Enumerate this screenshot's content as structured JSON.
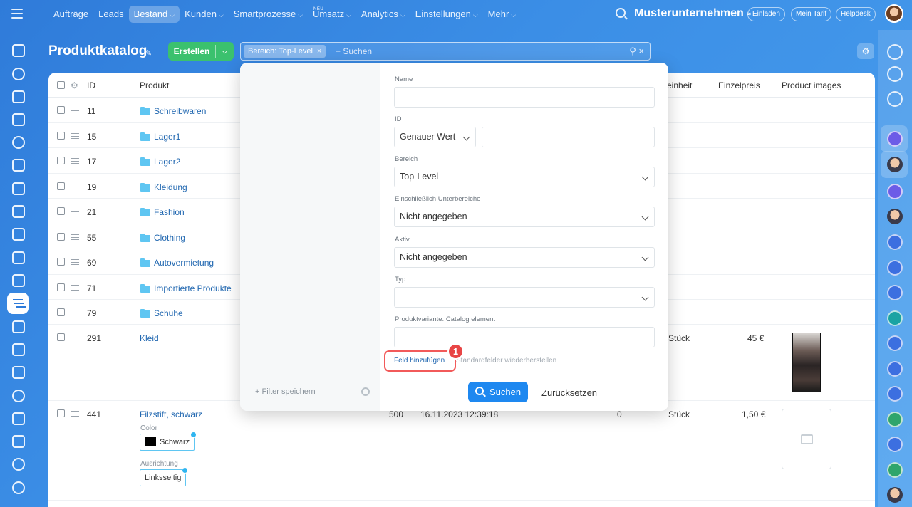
{
  "topnav": {
    "items": [
      {
        "label": "Aufträge",
        "chev": ""
      },
      {
        "label": "Leads",
        "chev": ""
      },
      {
        "label": "Bestand",
        "chev": "⌵"
      },
      {
        "label": "Kunden",
        "chev": "⌵"
      },
      {
        "label": "Smartprozesse",
        "chev": "⌵"
      },
      {
        "label": "Umsatz",
        "chev": "⌵",
        "badge": "NEU"
      },
      {
        "label": "Analytics",
        "chev": "⌵"
      },
      {
        "label": "Einstellungen",
        "chev": "⌵"
      },
      {
        "label": "Mehr",
        "chev": "⌵"
      }
    ],
    "company": "Musterunternehmen",
    "company_icon": "≈",
    "invite": "Einladen",
    "plan": "Mein Tarif",
    "help": "Helpdesk"
  },
  "header": {
    "title": "Produktkatalog",
    "pin": "✎",
    "create": "Erstellen",
    "create_dd": "⌵",
    "filter_chip": "Bereich: Top-Level",
    "chip_close": "×",
    "search_placeholder": "+ Suchen",
    "search_icons": "⚲ ×",
    "settings_icon": "⚙"
  },
  "table": {
    "gear": "⚙",
    "col_id": "ID",
    "col_product": "Produkt",
    "col_unit": "einheit",
    "col_price": "Einzelpreis",
    "col_images": "Product images",
    "rows": [
      {
        "id": "11",
        "name": "Schreibwaren"
      },
      {
        "id": "15",
        "name": "Lager1"
      },
      {
        "id": "17",
        "name": "Lager2"
      },
      {
        "id": "19",
        "name": "Kleidung"
      },
      {
        "id": "21",
        "name": "Fashion"
      },
      {
        "id": "55",
        "name": "Clothing"
      },
      {
        "id": "69",
        "name": "Autovermietung"
      },
      {
        "id": "71",
        "name": "Importierte Produkte"
      },
      {
        "id": "79",
        "name": "Schuhe"
      }
    ],
    "kleid": {
      "id": "291",
      "name": "Kleid",
      "unit": "Stück",
      "price": "45 €"
    },
    "filz": {
      "id": "441",
      "name": "Filzstift, schwarz",
      "qty": "500",
      "date": "16.11.2023 12:39:18",
      "reserved": "0",
      "unit": "Stück",
      "price": "1,50 €",
      "color_label": "Color",
      "color_value": "Schwarz",
      "orient_label": "Ausrichtung",
      "orient_value": "Linksseitig"
    }
  },
  "filter": {
    "save_filter": "+ Filter speichern",
    "fields": {
      "name_label": "Name",
      "name_value": "",
      "id_label": "ID",
      "id_mode": "Genauer Wert",
      "id_value": "",
      "bereich_label": "Bereich",
      "bereich_value": "Top-Level",
      "sub_label": "Einschließlich Unterbereiche",
      "sub_value": "Nicht angegeben",
      "aktiv_label": "Aktiv",
      "aktiv_value": "Nicht angegeben",
      "typ_label": "Typ",
      "typ_value": "",
      "variant_label": "Produktvariante: Catalog element",
      "variant_value": ""
    },
    "add_field": "Feld hinzufügen",
    "restore": "Standardfelder wiederherstellen",
    "badge": "1",
    "search": "Suchen",
    "reset": "Zurücksetzen"
  },
  "colors": {
    "accent": "#1e88f0",
    "create": "#3bc16e",
    "highlight": "#f25a5a",
    "link": "#2067b0"
  }
}
